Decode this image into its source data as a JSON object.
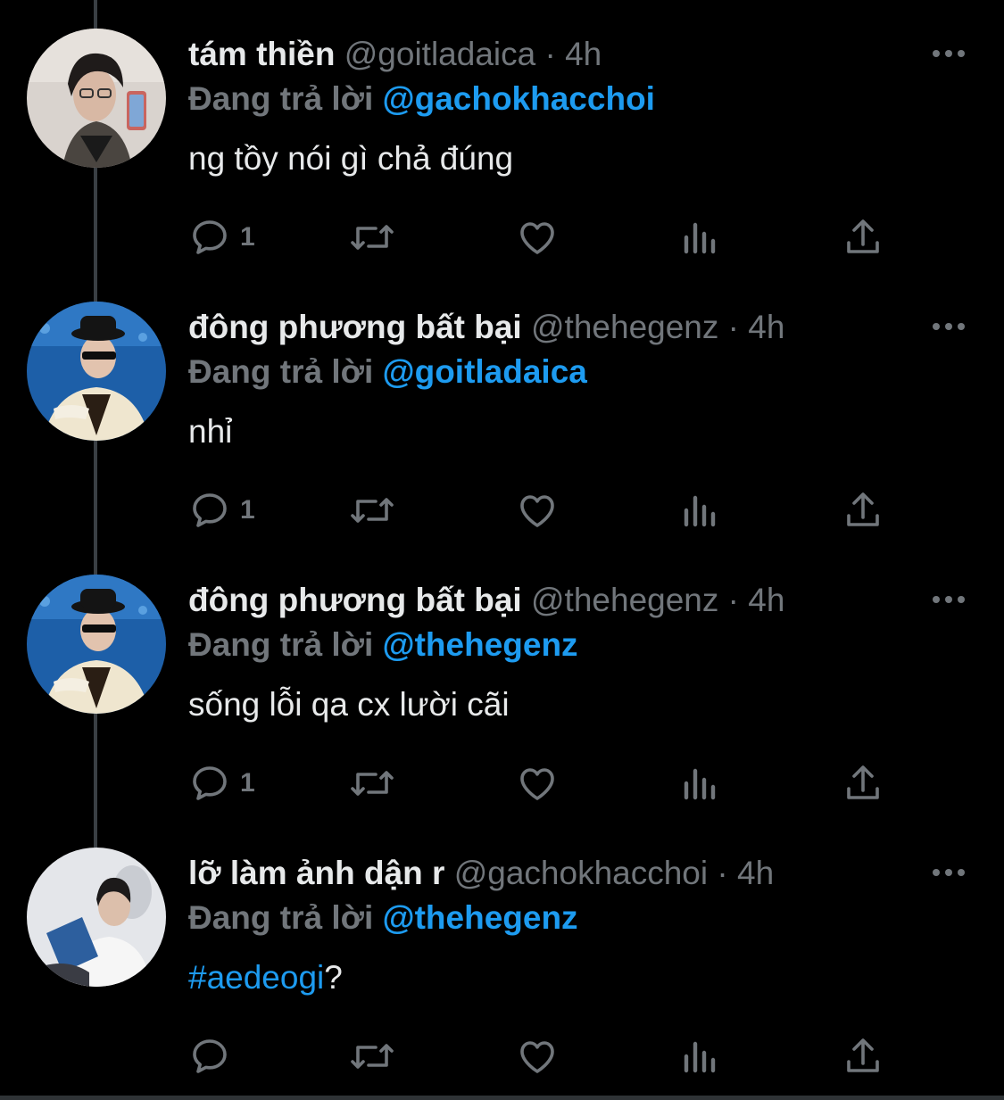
{
  "colors": {
    "background": "#000000",
    "text_primary": "#e7e9ea",
    "text_secondary": "#71767b",
    "link": "#1d9bf0"
  },
  "icons": {
    "reply": "reply-icon",
    "retweet": "retweet-icon",
    "like": "heart-icon",
    "views": "views-chart-icon",
    "share": "share-icon",
    "more": "more-dots-icon"
  },
  "tweets": [
    {
      "display_name": "tám thiền",
      "handle": "@goitladaica",
      "separator": "·",
      "time": "4h",
      "replying_prefix": "Đang trả lời",
      "replying_to": "@gachokhacchoi",
      "text": "ng tồy nói gì chả đúng",
      "hashtag": "",
      "text_suffix": "",
      "reply_count": "1"
    },
    {
      "display_name": "đông phương bất bại",
      "handle": "@thehegenz",
      "separator": "·",
      "time": "4h",
      "replying_prefix": "Đang trả lời",
      "replying_to": "@goitladaica",
      "text": "nhỉ",
      "hashtag": "",
      "text_suffix": "",
      "reply_count": "1"
    },
    {
      "display_name": "đông phương bất bại",
      "handle": "@thehegenz",
      "separator": "·",
      "time": "4h",
      "replying_prefix": "Đang trả lời",
      "replying_to": "@thehegenz",
      "text": "sống lỗi qa cx lười cãi",
      "hashtag": "",
      "text_suffix": "",
      "reply_count": "1"
    },
    {
      "display_name": "lỡ làm ảnh dận r",
      "handle": "@gachokhacchoi",
      "separator": "·",
      "time": "4h",
      "replying_prefix": "Đang trả lời",
      "replying_to": "@thehegenz",
      "text": "",
      "hashtag": "#aedeogi",
      "text_suffix": "?",
      "reply_count": ""
    }
  ]
}
